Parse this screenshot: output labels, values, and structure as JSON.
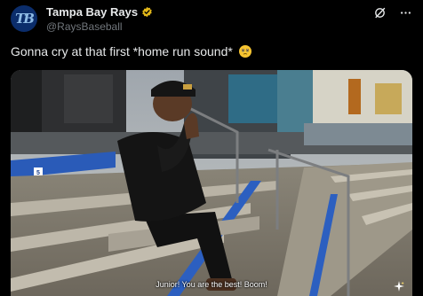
{
  "account": {
    "display_name": "Tampa Bay Rays",
    "handle": "@RaysBaseball",
    "avatar_initials": "TB"
  },
  "post": {
    "text": "Gonna cry at that first *home run sound*"
  },
  "media": {
    "caption": "Junior! You are the best! Boom!",
    "seat_number": "5"
  },
  "icons": {
    "verified": "verified-badge-icon",
    "grok": "grok-icon",
    "more": "more-icon",
    "emoji": "face-holding-back-tears-emoji",
    "sparkle": "sparkle-icon"
  },
  "colors": {
    "background": "#000000",
    "text_primary": "#e7e9ea",
    "text_secondary": "#71767b",
    "verified_gold": "#e2b719",
    "stadium_blue": "#2a5bb8"
  }
}
